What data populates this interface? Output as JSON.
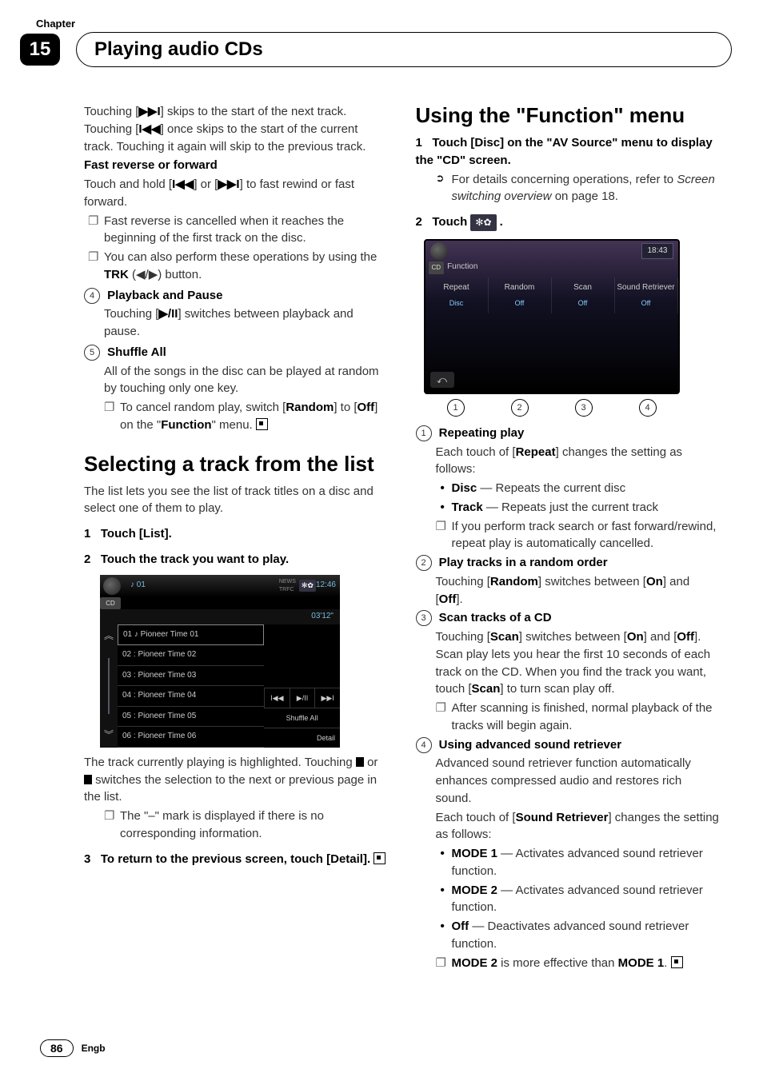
{
  "chapter_label": "Chapter",
  "chapter_number": "15",
  "title": "Playing audio CDs",
  "left": {
    "p_skip_1": "Touching [",
    "p_skip_2": "] skips to the start of the next track. Touching [",
    "p_skip_3": "] once skips to the start of the current track. Touching it again will skip to the previous track.",
    "h_fast": "Fast reverse or forward",
    "p_fast_1": "Touch and hold [",
    "p_fast_2": "] or [",
    "p_fast_3": "] to fast rewind or fast forward.",
    "bul_fr1": "Fast reverse is cancelled when it reaches the beginning of the first track on the disc.",
    "bul_fr2a": "You can also perform these operations by using the ",
    "bul_fr2b": "TRK",
    "bul_fr2c": " (◀/▶) button.",
    "n4": "④",
    "h_play": "Playback and Pause",
    "p_play_1": "Touching [",
    "p_play_2": "] switches between playback and pause.",
    "n5": "⑤",
    "h_shuffle": "Shuffle All",
    "p_shuffle": "All of the songs in the disc can be played at random by touching only one key.",
    "bul_sh1a": "To cancel random play, switch [",
    "bul_sh1_random": "Random",
    "bul_sh1_b": "] to [",
    "bul_sh1_off": "Off",
    "bul_sh1_c": "] on the \"",
    "bul_sh1_func": "Function",
    "bul_sh1_d": "\" menu.",
    "h_select": "Selecting a track from the list",
    "p_select": "The list lets you see the list of track titles on a disc and select one of them to play.",
    "step1": "Touch [List].",
    "step2": "Touch the track you want to play.",
    "fig": {
      "now": "♪ 01",
      "time": "12:46",
      "elapsed": "03'12\"",
      "items": [
        "01 ♪ Pioneer Time 01",
        "02 : Pioneer Time 02",
        "03 : Pioneer Time 03",
        "04 : Pioneer Time 04",
        "05 : Pioneer Time 05",
        "06 : Pioneer Time 06"
      ],
      "shuffle": "Shuffle All",
      "detail": "Detail",
      "cd": "CD"
    },
    "p_highlight_1": "The track currently playing is highlighted. Touching ",
    "p_highlight_2": " or ",
    "p_highlight_3": " switches the selection to the next or previous page in the list.",
    "bul_mark": "The \"–\" mark is displayed if there is no corresponding information.",
    "step3a": "To return to the previous screen, touch [Detail].",
    "step3_label": "3"
  },
  "right": {
    "h_func": "Using the \"Function\" menu",
    "step1": "Touch [Disc] on the \"AV Source\" menu to display the \"CD\" screen.",
    "refer_a": "For details concerning operations, refer to ",
    "refer_i": "Screen switching overview",
    "refer_b": " on page 18.",
    "step2_a": "Touch ",
    "fig": {
      "clock": "18:43",
      "cd": "CD",
      "function": "Function",
      "items": [
        {
          "label": "Repeat",
          "sub": "Disc"
        },
        {
          "label": "Random",
          "sub": "Off"
        },
        {
          "label": "Scan",
          "sub": "Off"
        },
        {
          "label": "Sound Retriever",
          "sub": "Off"
        }
      ],
      "callouts": [
        "1",
        "2",
        "3",
        "4"
      ]
    },
    "i1_h": "Repeating play",
    "i1_p_a": "Each touch of [",
    "i1_repeat": "Repeat",
    "i1_p_b": "] changes the setting as follows:",
    "i1_disc_a": "Disc",
    "i1_disc_b": " — Repeats the current disc",
    "i1_track_a": "Track",
    "i1_track_b": " — Repeats just the current track",
    "i1_note": "If you perform track search or fast forward/rewind, repeat play is automatically cancelled.",
    "i2_h": "Play tracks in a random order",
    "i2_p_a": "Touching [",
    "i2_random": "Random",
    "i2_p_b": "] switches between [",
    "i2_on": "On",
    "i2_p_c": "] and [",
    "i2_off": "Off",
    "i2_p_d": "].",
    "i3_h": "Scan tracks of a CD",
    "i3_p_a": "Touching [",
    "i3_scan": "Scan",
    "i3_p_b": "] switches between [",
    "i3_on": "On",
    "i3_p_c": "] and [",
    "i3_off": "Off",
    "i3_p_d": "]. Scan play lets you hear the first 10 seconds of each track on the CD. When you find the track you want, touch [",
    "i3_scan2": "Scan",
    "i3_p_e": "] to turn scan play off.",
    "i3_note": "After scanning is finished, normal playback of the tracks will begin again.",
    "i4_h": "Using advanced sound retriever",
    "i4_p": "Advanced sound retriever function automatically enhances compressed audio and restores rich sound.",
    "i4_p2_a": "Each touch of [",
    "i4_sr": "Sound Retriever",
    "i4_p2_b": "] changes the setting as follows:",
    "i4_m1a": "MODE 1",
    "i4_m1b": " — Activates advanced sound retriever function.",
    "i4_m2a": "MODE 2",
    "i4_m2b": " — Activates advanced sound retriever function.",
    "i4_offa": "Off",
    "i4_offb": " — Deactivates advanced sound retriever function.",
    "i4_note_a": "MODE 2",
    "i4_note_b": " is more effective than ",
    "i4_note_c": "MODE 1"
  },
  "page_number": "86",
  "lang": "Engb"
}
